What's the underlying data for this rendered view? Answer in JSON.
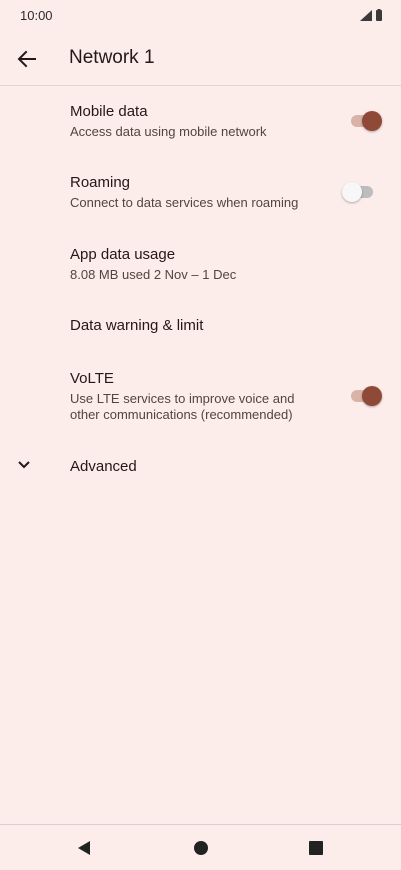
{
  "status_bar": {
    "time": "10:00",
    "icons": [
      "signal-icon",
      "battery-icon"
    ]
  },
  "app_bar": {
    "title": "Network 1",
    "back_icon": "arrow-left-icon"
  },
  "preferences": [
    {
      "title": "Mobile data",
      "summary": "Access data using mobile network",
      "toggle": true
    },
    {
      "title": "Roaming",
      "summary": "Connect to data services when roaming",
      "toggle": false
    },
    {
      "title": "App data usage",
      "summary": "8.08 MB used 2 Nov – 1 Dec"
    },
    {
      "title": "Data warning & limit"
    },
    {
      "title": "VoLTE",
      "summary_line1": "Use LTE services to improve voice and",
      "summary_line2": "other communications (recommended)",
      "toggle": true
    },
    {
      "title": "Advanced",
      "icon": "chevron-down-icon"
    }
  ],
  "nav_bar": {
    "back": "back-triangle-icon",
    "home": "home-circle-icon",
    "recents": "recents-square-icon"
  },
  "colors": {
    "background": "#fcecea",
    "accent": "#8f4a37"
  }
}
